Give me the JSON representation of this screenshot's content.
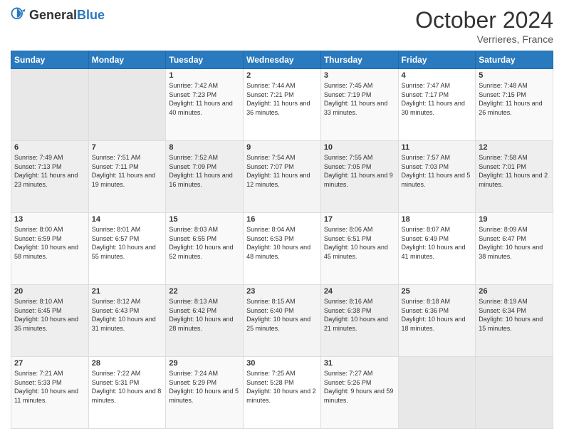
{
  "header": {
    "logo_general": "General",
    "logo_blue": "Blue",
    "month_title": "October 2024",
    "location": "Verrieres, France"
  },
  "days_of_week": [
    "Sunday",
    "Monday",
    "Tuesday",
    "Wednesday",
    "Thursday",
    "Friday",
    "Saturday"
  ],
  "weeks": [
    [
      {
        "day": "",
        "sunrise": "",
        "sunset": "",
        "daylight": ""
      },
      {
        "day": "",
        "sunrise": "",
        "sunset": "",
        "daylight": ""
      },
      {
        "day": "1",
        "sunrise": "Sunrise: 7:42 AM",
        "sunset": "Sunset: 7:23 PM",
        "daylight": "Daylight: 11 hours and 40 minutes."
      },
      {
        "day": "2",
        "sunrise": "Sunrise: 7:44 AM",
        "sunset": "Sunset: 7:21 PM",
        "daylight": "Daylight: 11 hours and 36 minutes."
      },
      {
        "day": "3",
        "sunrise": "Sunrise: 7:45 AM",
        "sunset": "Sunset: 7:19 PM",
        "daylight": "Daylight: 11 hours and 33 minutes."
      },
      {
        "day": "4",
        "sunrise": "Sunrise: 7:47 AM",
        "sunset": "Sunset: 7:17 PM",
        "daylight": "Daylight: 11 hours and 30 minutes."
      },
      {
        "day": "5",
        "sunrise": "Sunrise: 7:48 AM",
        "sunset": "Sunset: 7:15 PM",
        "daylight": "Daylight: 11 hours and 26 minutes."
      }
    ],
    [
      {
        "day": "6",
        "sunrise": "Sunrise: 7:49 AM",
        "sunset": "Sunset: 7:13 PM",
        "daylight": "Daylight: 11 hours and 23 minutes."
      },
      {
        "day": "7",
        "sunrise": "Sunrise: 7:51 AM",
        "sunset": "Sunset: 7:11 PM",
        "daylight": "Daylight: 11 hours and 19 minutes."
      },
      {
        "day": "8",
        "sunrise": "Sunrise: 7:52 AM",
        "sunset": "Sunset: 7:09 PM",
        "daylight": "Daylight: 11 hours and 16 minutes."
      },
      {
        "day": "9",
        "sunrise": "Sunrise: 7:54 AM",
        "sunset": "Sunset: 7:07 PM",
        "daylight": "Daylight: 11 hours and 12 minutes."
      },
      {
        "day": "10",
        "sunrise": "Sunrise: 7:55 AM",
        "sunset": "Sunset: 7:05 PM",
        "daylight": "Daylight: 11 hours and 9 minutes."
      },
      {
        "day": "11",
        "sunrise": "Sunrise: 7:57 AM",
        "sunset": "Sunset: 7:03 PM",
        "daylight": "Daylight: 11 hours and 5 minutes."
      },
      {
        "day": "12",
        "sunrise": "Sunrise: 7:58 AM",
        "sunset": "Sunset: 7:01 PM",
        "daylight": "Daylight: 11 hours and 2 minutes."
      }
    ],
    [
      {
        "day": "13",
        "sunrise": "Sunrise: 8:00 AM",
        "sunset": "Sunset: 6:59 PM",
        "daylight": "Daylight: 10 hours and 58 minutes."
      },
      {
        "day": "14",
        "sunrise": "Sunrise: 8:01 AM",
        "sunset": "Sunset: 6:57 PM",
        "daylight": "Daylight: 10 hours and 55 minutes."
      },
      {
        "day": "15",
        "sunrise": "Sunrise: 8:03 AM",
        "sunset": "Sunset: 6:55 PM",
        "daylight": "Daylight: 10 hours and 52 minutes."
      },
      {
        "day": "16",
        "sunrise": "Sunrise: 8:04 AM",
        "sunset": "Sunset: 6:53 PM",
        "daylight": "Daylight: 10 hours and 48 minutes."
      },
      {
        "day": "17",
        "sunrise": "Sunrise: 8:06 AM",
        "sunset": "Sunset: 6:51 PM",
        "daylight": "Daylight: 10 hours and 45 minutes."
      },
      {
        "day": "18",
        "sunrise": "Sunrise: 8:07 AM",
        "sunset": "Sunset: 6:49 PM",
        "daylight": "Daylight: 10 hours and 41 minutes."
      },
      {
        "day": "19",
        "sunrise": "Sunrise: 8:09 AM",
        "sunset": "Sunset: 6:47 PM",
        "daylight": "Daylight: 10 hours and 38 minutes."
      }
    ],
    [
      {
        "day": "20",
        "sunrise": "Sunrise: 8:10 AM",
        "sunset": "Sunset: 6:45 PM",
        "daylight": "Daylight: 10 hours and 35 minutes."
      },
      {
        "day": "21",
        "sunrise": "Sunrise: 8:12 AM",
        "sunset": "Sunset: 6:43 PM",
        "daylight": "Daylight: 10 hours and 31 minutes."
      },
      {
        "day": "22",
        "sunrise": "Sunrise: 8:13 AM",
        "sunset": "Sunset: 6:42 PM",
        "daylight": "Daylight: 10 hours and 28 minutes."
      },
      {
        "day": "23",
        "sunrise": "Sunrise: 8:15 AM",
        "sunset": "Sunset: 6:40 PM",
        "daylight": "Daylight: 10 hours and 25 minutes."
      },
      {
        "day": "24",
        "sunrise": "Sunrise: 8:16 AM",
        "sunset": "Sunset: 6:38 PM",
        "daylight": "Daylight: 10 hours and 21 minutes."
      },
      {
        "day": "25",
        "sunrise": "Sunrise: 8:18 AM",
        "sunset": "Sunset: 6:36 PM",
        "daylight": "Daylight: 10 hours and 18 minutes."
      },
      {
        "day": "26",
        "sunrise": "Sunrise: 8:19 AM",
        "sunset": "Sunset: 6:34 PM",
        "daylight": "Daylight: 10 hours and 15 minutes."
      }
    ],
    [
      {
        "day": "27",
        "sunrise": "Sunrise: 7:21 AM",
        "sunset": "Sunset: 5:33 PM",
        "daylight": "Daylight: 10 hours and 11 minutes."
      },
      {
        "day": "28",
        "sunrise": "Sunrise: 7:22 AM",
        "sunset": "Sunset: 5:31 PM",
        "daylight": "Daylight: 10 hours and 8 minutes."
      },
      {
        "day": "29",
        "sunrise": "Sunrise: 7:24 AM",
        "sunset": "Sunset: 5:29 PM",
        "daylight": "Daylight: 10 hours and 5 minutes."
      },
      {
        "day": "30",
        "sunrise": "Sunrise: 7:25 AM",
        "sunset": "Sunset: 5:28 PM",
        "daylight": "Daylight: 10 hours and 2 minutes."
      },
      {
        "day": "31",
        "sunrise": "Sunrise: 7:27 AM",
        "sunset": "Sunset: 5:26 PM",
        "daylight": "Daylight: 9 hours and 59 minutes."
      },
      {
        "day": "",
        "sunrise": "",
        "sunset": "",
        "daylight": ""
      },
      {
        "day": "",
        "sunrise": "",
        "sunset": "",
        "daylight": ""
      }
    ]
  ]
}
